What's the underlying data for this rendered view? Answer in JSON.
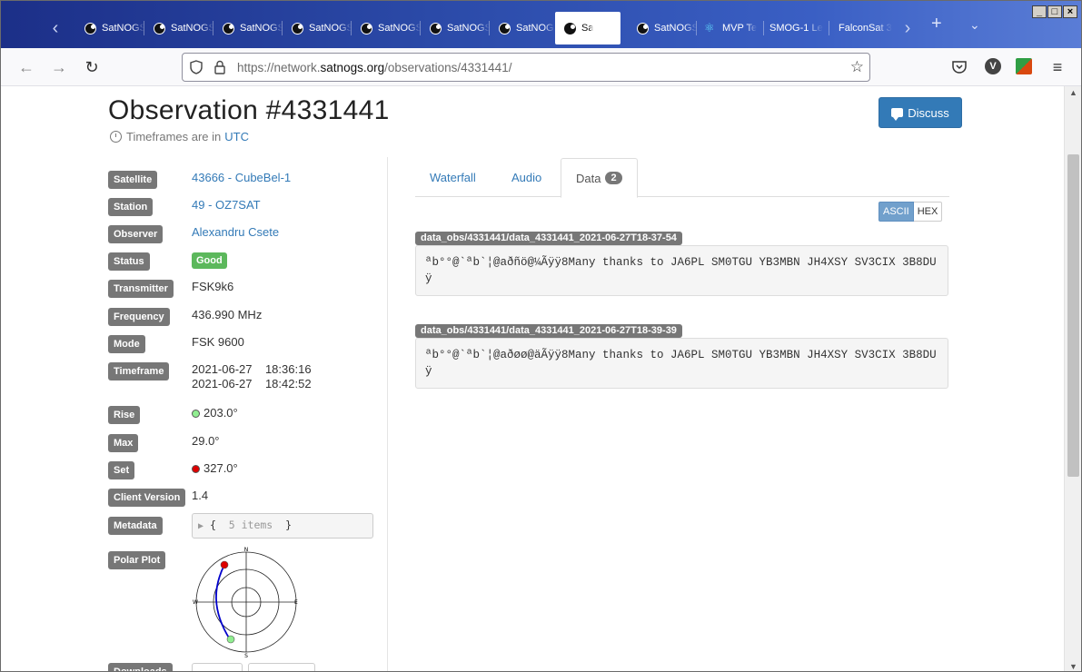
{
  "browser": {
    "tabs": [
      {
        "label": "SatNOGS",
        "type": "satnogs"
      },
      {
        "label": "SatNOGS",
        "type": "satnogs"
      },
      {
        "label": "SatNOGS",
        "type": "satnogs"
      },
      {
        "label": "SatNOGS",
        "type": "satnogs"
      },
      {
        "label": "SatNOGS",
        "type": "satnogs"
      },
      {
        "label": "SatNOGS",
        "type": "satnogs"
      },
      {
        "label": "SatNOGS",
        "type": "satnogs"
      },
      {
        "label": "Sa",
        "type": "satnogs",
        "active": true
      },
      {
        "label": "SatNOGS",
        "type": "satnogs"
      },
      {
        "label": "MVP Te",
        "type": "react"
      },
      {
        "label": "SMOG-1 Le",
        "type": "plain"
      },
      {
        "label": "FalconSat 3",
        "type": "plain"
      }
    ],
    "url_prefix": "https://network.",
    "url_domain": "satnogs.org",
    "url_path": "/observations/4331441/",
    "profile_initial": "V"
  },
  "header": {
    "title": "Observation #4331441",
    "timeframes_text": "Timeframes are in",
    "timezone": "UTC",
    "discuss_label": "Discuss"
  },
  "details": {
    "satellite_label": "Satellite",
    "satellite_value": "43666 - CubeBel-1",
    "station_label": "Station",
    "station_value": "49 - OZ7SAT",
    "observer_label": "Observer",
    "observer_value": "Alexandru Csete",
    "status_label": "Status",
    "status_value": "Good",
    "transmitter_label": "Transmitter",
    "transmitter_value": "FSK9k6",
    "frequency_label": "Frequency",
    "frequency_value": "436.990 MHz",
    "mode_label": "Mode",
    "mode_value": "FSK 9600",
    "timeframe_label": "Timeframe",
    "timeframe_start_date": "2021-06-27",
    "timeframe_start_time": "18:36:16",
    "timeframe_end_date": "2021-06-27",
    "timeframe_end_time": "18:42:52",
    "rise_label": "Rise",
    "rise_value": "203.0°",
    "max_label": "Max",
    "max_value": "29.0°",
    "set_label": "Set",
    "set_value": "327.0°",
    "client_label": "Client Version",
    "client_value": "1.4",
    "metadata_label": "Metadata",
    "metadata_open": "{",
    "metadata_count": "5 items",
    "metadata_close": "}",
    "polar_label": "Polar Plot",
    "polar_n": "N",
    "polar_e": "E",
    "polar_s": "S",
    "polar_w": "W",
    "downloads_label": "Downloads"
  },
  "data_tabs": {
    "waterfall": "Waterfall",
    "audio": "Audio",
    "data": "Data",
    "data_count": "2",
    "ascii": "ASCII",
    "hex": "HEX"
  },
  "frames": [
    {
      "name": "data_obs/4331441/data_4331441_2021-06-27T18-37-54",
      "content": "ªb°°@`ªb`¦@aðñö@¼Ãÿÿ8Many thanks to JA6PL SM0TGU YB3MBN JH4XSY SV3CIX 3B8DUÿ"
    },
    {
      "name": "data_obs/4331441/data_4331441_2021-06-27T18-39-39",
      "content": "ªb°°@`ªb`¦@aðøø@äÃÿÿ8Many thanks to JA6PL SM0TGU YB3MBN JH4XSY SV3CIX 3B8DUÿ"
    }
  ],
  "colors": {
    "link": "#337ab7",
    "label_bg": "#777777",
    "good": "#5cb85c",
    "rise_dot": "#90ee90",
    "set_dot": "#dd0000",
    "path": "#0000cc"
  }
}
